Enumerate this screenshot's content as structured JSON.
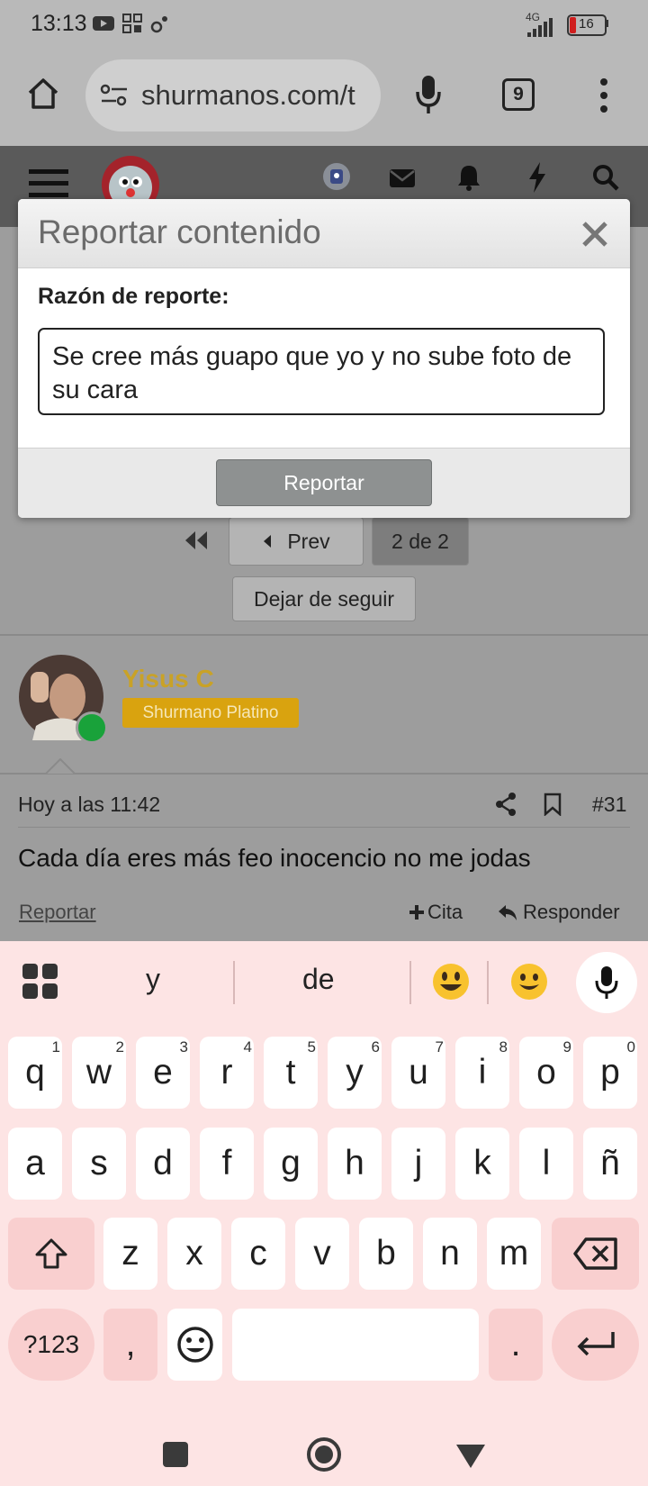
{
  "status_bar": {
    "time": "13:13",
    "network": "4G",
    "battery": "16"
  },
  "browser": {
    "url": "shurmanos.com/t",
    "tab_count": "9"
  },
  "modal": {
    "title": "Reportar contenido",
    "reason_label": "Razón de reporte:",
    "reason_text": "Se cree más guapo que yo y no sube foto de su cara",
    "submit_label": "Reportar"
  },
  "pagination": {
    "prev_label": "Prev",
    "current_label": "2 de 2"
  },
  "unfollow_label": "Dejar de seguir",
  "post": {
    "author": "Yisus C",
    "rank": "Shurmano Platino",
    "timestamp": "Hoy a las 11:42",
    "number": "#31",
    "body": "Cada día eres más feo inocencio no me jodas",
    "report_label": "Reportar",
    "quote_label": "Cita",
    "reply_label": "Responder"
  },
  "keyboard": {
    "suggestions": [
      "y",
      "de"
    ],
    "row1": [
      {
        "k": "q",
        "n": "1"
      },
      {
        "k": "w",
        "n": "2"
      },
      {
        "k": "e",
        "n": "3"
      },
      {
        "k": "r",
        "n": "4"
      },
      {
        "k": "t",
        "n": "5"
      },
      {
        "k": "y",
        "n": "6"
      },
      {
        "k": "u",
        "n": "7"
      },
      {
        "k": "i",
        "n": "8"
      },
      {
        "k": "o",
        "n": "9"
      },
      {
        "k": "p",
        "n": "0"
      }
    ],
    "row2": [
      "a",
      "s",
      "d",
      "f",
      "g",
      "h",
      "j",
      "k",
      "l",
      "ñ"
    ],
    "row3": [
      "z",
      "x",
      "c",
      "v",
      "b",
      "n",
      "m"
    ],
    "symbols_label": "?123",
    "comma": ",",
    "period": "."
  },
  "colors": {
    "author": "#c9a227",
    "rank_badge": "#d9a30f",
    "online": "#19a23a"
  }
}
